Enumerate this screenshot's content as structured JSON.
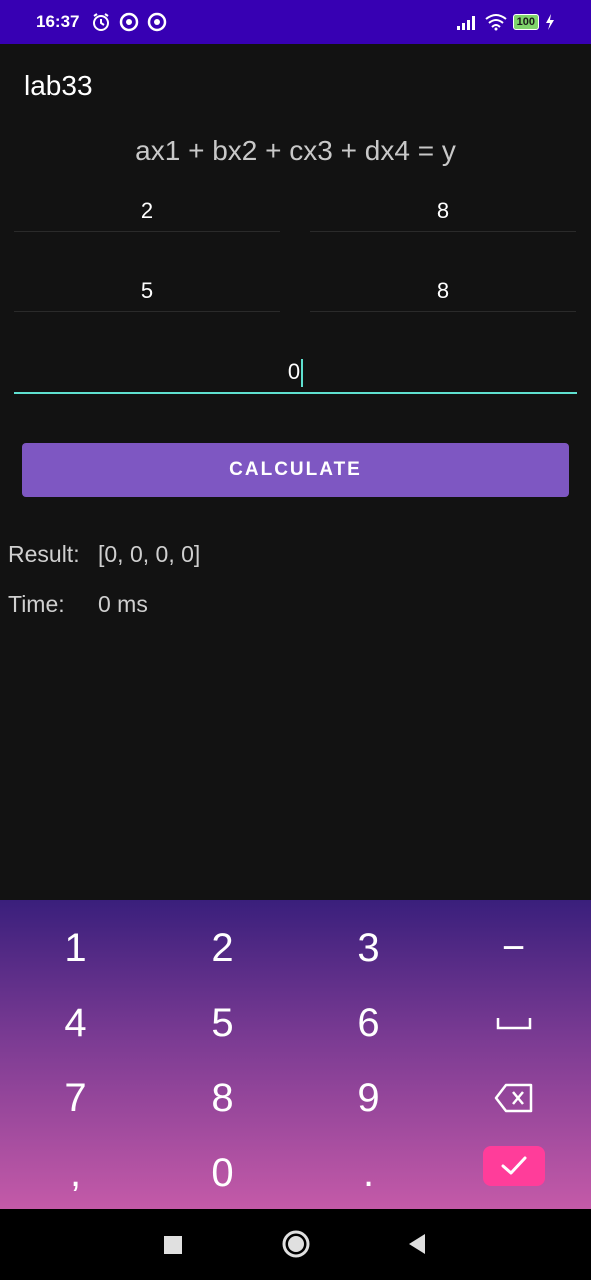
{
  "status_bar": {
    "time": "16:37",
    "battery": "100"
  },
  "app": {
    "title": "lab33"
  },
  "equation": "ax1 + bx2 + cx3 + dx4 = y",
  "fields": {
    "a": "2",
    "b": "8",
    "c": "5",
    "d": "8",
    "y": "0"
  },
  "button": {
    "calculate": "CALCULATE"
  },
  "output": {
    "result_label": "Result:",
    "result_value": "[0, 0, 0, 0]",
    "time_label": "Time:",
    "time_value": "0 ms"
  },
  "keyboard": {
    "keys": [
      "1",
      "2",
      "3",
      "−",
      "4",
      "5",
      "6",
      "7",
      "8",
      "9",
      ",",
      "0",
      "."
    ]
  },
  "colors": {
    "status_bar": "#3700b3",
    "accent": "#7e57c2",
    "field_focus": "#5fe0d0",
    "enter": "#ff3d9a"
  }
}
